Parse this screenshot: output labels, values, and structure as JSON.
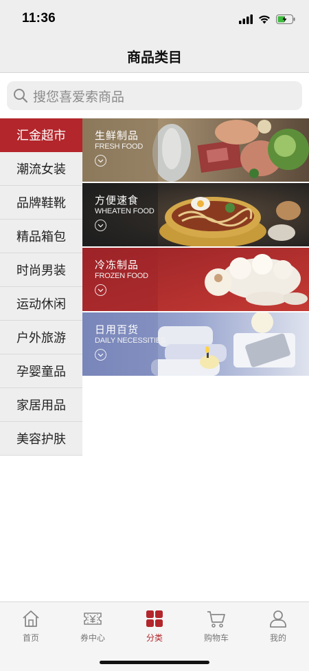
{
  "status_bar": {
    "time": "11:36"
  },
  "nav": {
    "title": "商品类目"
  },
  "search": {
    "placeholder": "搜您喜爱索商品",
    "icon": "search-icon"
  },
  "sidebar": {
    "items": [
      {
        "label": "汇金超市",
        "active": true
      },
      {
        "label": "潮流女装"
      },
      {
        "label": "品牌鞋靴"
      },
      {
        "label": "精品箱包"
      },
      {
        "label": "时尚男装"
      },
      {
        "label": "运动休闲"
      },
      {
        "label": "户外旅游"
      },
      {
        "label": "孕婴童品"
      },
      {
        "label": "家居用品"
      },
      {
        "label": "美容护肤"
      }
    ]
  },
  "banners": [
    {
      "title": "生鲜制品",
      "subtitle": "FRESH FOOD",
      "color": "#8c7a5e"
    },
    {
      "title": "方便速食",
      "subtitle": "WHEATEN FOOD",
      "color": "#2a2a2a"
    },
    {
      "title": "冷冻制品",
      "subtitle": "FROZEN FOOD",
      "color": "#a3262a"
    },
    {
      "title": "日用百货",
      "subtitle": "DAILY NECESSITIES",
      "color": "#7f8cbf"
    }
  ],
  "tab_bar": {
    "tabs": [
      {
        "label": "首页",
        "icon": "home-icon"
      },
      {
        "label": "券中心",
        "icon": "coupon-icon"
      },
      {
        "label": "分类",
        "icon": "category-icon",
        "active": true
      },
      {
        "label": "购物车",
        "icon": "cart-icon"
      },
      {
        "label": "我的",
        "icon": "user-icon"
      }
    ]
  },
  "colors": {
    "accent": "#b3262b",
    "background": "#eeeeee"
  }
}
